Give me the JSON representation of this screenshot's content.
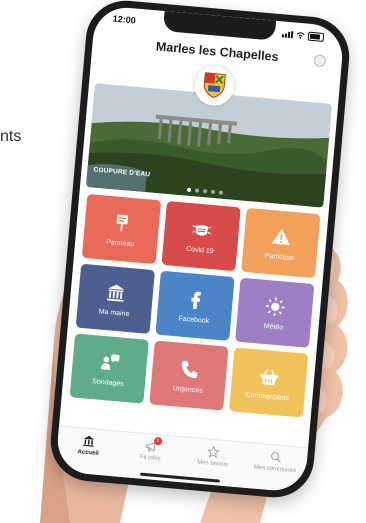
{
  "background_text": "nts",
  "status_bar": {
    "time": "12:00"
  },
  "app": {
    "title": "Marles les Chapelles"
  },
  "banner": {
    "caption": "COUPURE D'EAU",
    "slide_count": 5,
    "active_slide": 1
  },
  "tiles": [
    {
      "label": "Panneau",
      "icon": "signpost-icon",
      "color": "#e86b5a"
    },
    {
      "label": "Covid 19",
      "icon": "mask-icon",
      "color": "#d84b4b"
    },
    {
      "label": "Participer",
      "icon": "warning-icon",
      "color": "#f2a15c"
    },
    {
      "label": "Ma mairie",
      "icon": "town-hall-icon",
      "color": "#4e5e8e"
    },
    {
      "label": "Facebook",
      "icon": "facebook-icon",
      "color": "#4a86c5"
    },
    {
      "label": "Météo",
      "icon": "sun-icon",
      "color": "#9c7fc4"
    },
    {
      "label": "Sondages",
      "icon": "survey-icon",
      "color": "#5fae89"
    },
    {
      "label": "Urgences",
      "icon": "phone-icon",
      "color": "#e07878"
    },
    {
      "label": "Commerçants",
      "icon": "basket-icon",
      "color": "#f2c25a"
    }
  ],
  "tabs": [
    {
      "label": "Accueil",
      "icon": "home-icon",
      "active": true
    },
    {
      "label": "Fil infos",
      "icon": "megaphone-icon",
      "badge": "1"
    },
    {
      "label": "Mes favoris",
      "icon": "star-icon"
    },
    {
      "label": "Mes communes",
      "icon": "search-icon"
    }
  ]
}
